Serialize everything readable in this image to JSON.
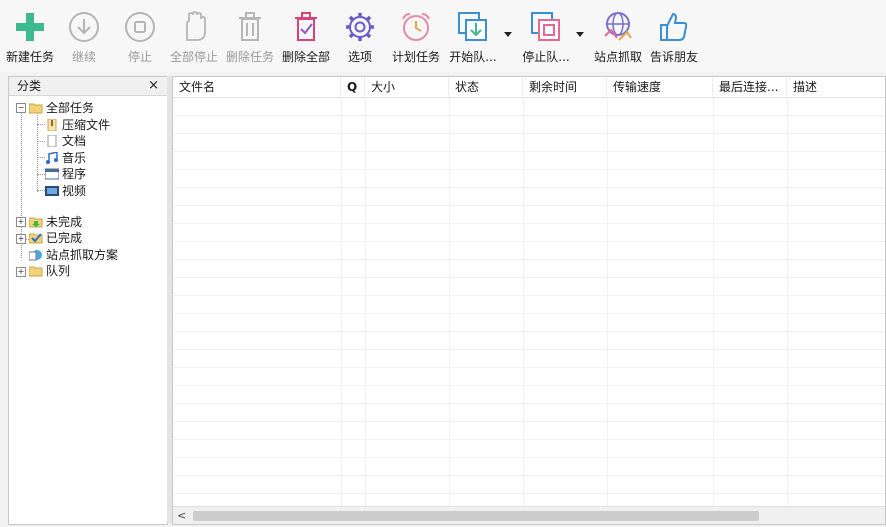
{
  "toolbar": {
    "buttons": [
      {
        "label": "新建任务",
        "icon": "plus-icon",
        "enabled": true
      },
      {
        "label": "继续",
        "icon": "download-circle-icon",
        "enabled": false
      },
      {
        "label": "停止",
        "icon": "stop-circle-icon",
        "enabled": false
      },
      {
        "label": "全部停止",
        "icon": "hand-icon",
        "enabled": false
      },
      {
        "label": "删除任务",
        "icon": "trash-icon",
        "enabled": false
      },
      {
        "label": "删除全部",
        "icon": "trash-check-icon",
        "enabled": true
      },
      {
        "label": "选项",
        "icon": "gear-icon",
        "enabled": true
      },
      {
        "label": "计划任务",
        "icon": "alarm-clock-icon",
        "enabled": true
      },
      {
        "label": "开始队...",
        "icon": "queue-start-icon",
        "enabled": true
      },
      {
        "label": "停止队...",
        "icon": "queue-stop-icon",
        "enabled": true
      },
      {
        "label": "站点抓取",
        "icon": "globe-grab-icon",
        "enabled": true
      },
      {
        "label": "告诉朋友",
        "icon": "thumbs-up-icon",
        "enabled": true
      }
    ]
  },
  "categories": {
    "title": "分类",
    "close": "×",
    "tree": [
      {
        "label": "全部任务",
        "icon": "folder-open-icon",
        "expander": "−"
      },
      {
        "label": "压缩文件",
        "icon": "zip-icon"
      },
      {
        "label": "文档",
        "icon": "document-icon"
      },
      {
        "label": "音乐",
        "icon": "music-icon"
      },
      {
        "label": "程序",
        "icon": "program-icon"
      },
      {
        "label": "视频",
        "icon": "video-icon"
      },
      {
        "label": "未完成",
        "icon": "folder-download-icon",
        "expander": "+"
      },
      {
        "label": "已完成",
        "icon": "folder-check-icon",
        "expander": "+"
      },
      {
        "label": "站点抓取方案",
        "icon": "site-grab-icon"
      },
      {
        "label": "队列",
        "icon": "folder-icon",
        "expander": "+"
      }
    ]
  },
  "columns": [
    {
      "label": "文件名"
    },
    {
      "label": "Q"
    },
    {
      "label": "大小"
    },
    {
      "label": "状态"
    },
    {
      "label": "剩余时间"
    },
    {
      "label": "传输速度"
    },
    {
      "label": "最后连接..."
    },
    {
      "label": "描述"
    }
  ],
  "scrollbar": {
    "left_arrow": "<"
  }
}
